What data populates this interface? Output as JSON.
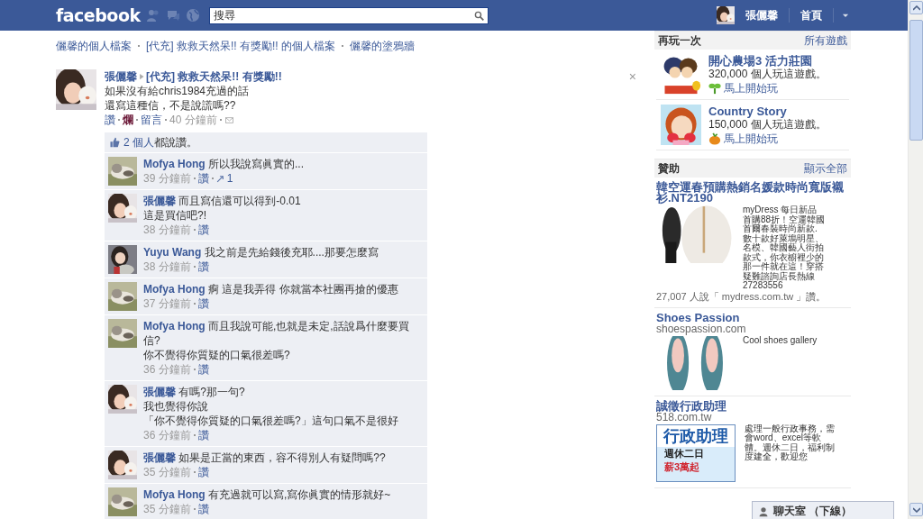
{
  "topbar": {
    "logo": "facebook",
    "search": {
      "placeholder": "搜尋"
    },
    "user_name": "張儷馨",
    "home": "首頁"
  },
  "breadcrumb": [
    "儷馨的個人檔案",
    "[代充] 救救天然呆!! 有獎勵!! 的個人檔案",
    "儷馨的塗鴉牆"
  ],
  "post": {
    "author": "張儷馨",
    "target": "[代充] 救救天然呆!! 有獎勵!!",
    "close": "×",
    "lines": [
      "如果沒有給chris1984充過的話",
      "還寫這種信，不是說謊嗎??"
    ],
    "actions": [
      {
        "label": "讚",
        "kind": "like"
      },
      {
        "label": "爛",
        "kind": "dislike"
      },
      {
        "label": "留言",
        "kind": "comment"
      }
    ],
    "time": "40 分鐘前",
    "likes": {
      "people": "2 個人",
      "text": "都說讚。"
    },
    "comments": [
      {
        "author": "Mofya Hong",
        "lines": [
          "所以我說寫眞實的..."
        ],
        "time": "39 分鐘前",
        "like": "讚",
        "shares": "1"
      },
      {
        "author": "張儷馨",
        "lines": [
          "而且寫信還可以得到-0.01",
          "這是買信吧?!"
        ],
        "time": "38 分鐘前",
        "like": "讚"
      },
      {
        "author": "Yuyu Wang",
        "lines": [
          "我之前是先給錢後充耶....那要怎麼寫"
        ],
        "time": "38 分鐘前",
        "like": "讚"
      },
      {
        "author": "Mofya Hong",
        "lines": [
          "痾 這是我弄得 你就當本社團再搶的優惠"
        ],
        "time": "37 分鐘前",
        "like": "讚"
      },
      {
        "author": "Mofya Hong",
        "lines": [
          "而且我說可能,也就是未定,話說爲什麼要買信?",
          "你不覺得你質疑的口氣很差嗎?"
        ],
        "time": "36 分鐘前",
        "like": "讚"
      },
      {
        "author": "張儷馨",
        "lines": [
          "有嗎?那一句?",
          "我也覺得你說",
          "「你不覺得你質疑的口氣很差嗎?」這句口氣不是很好"
        ],
        "time": "36 分鐘前",
        "like": "讚"
      },
      {
        "author": "張儷馨",
        "lines": [
          "如果是正當的東西，容不得別人有疑問嗎??"
        ],
        "time": "35 分鐘前",
        "like": "讚"
      },
      {
        "author": "Mofya Hong",
        "lines": [
          "有充過就可以寫,寫你眞實的情形就好~"
        ],
        "time": "35 分鐘前",
        "like": "讚"
      }
    ]
  },
  "games": {
    "title": "再玩一次",
    "link": "所有遊戲",
    "items": [
      {
        "title": "開心農場3 活力莊園",
        "players": "320,000 個人玩這遊戲。",
        "play": "馬上開始玩",
        "kind": "sprout"
      },
      {
        "title": "Country Story",
        "players": "150,000 個人玩這遊戲。",
        "play": "馬上開始玩",
        "kind": "pumpkin"
      }
    ]
  },
  "ads": {
    "title": "贊助",
    "link": "顯示全部",
    "items": [
      {
        "title": "韓空運春預購熱銷名媛款時尚寬版襯衫.NT2190",
        "body": "myDress 每日新品首購88折！空運韓國首爾春裝時尚新款.數十款好萊塢明星、名模、韓國藝人街拍款式，你衣櫥裡少的那一件就在這！穿搭疑難諮詢店長熱線27283556",
        "social": "27,007 人說「 mydress.com.tw 」讚。"
      },
      {
        "title": "Shoes Passion",
        "domain": "shoespassion.com",
        "body": "Cool shoes gallery"
      },
      {
        "title": "誠徵行政助理",
        "domain": "518.com.tw",
        "body": "處理一般行政事務，需會word、excel等軟體。週休二日，福利制度建全，歡迎您",
        "banner": {
          "headline": "行政助理",
          "points": [
            "週休二日",
            "薪3萬起"
          ]
        }
      }
    ]
  },
  "chat": {
    "label": "聊天室 （下線）"
  }
}
